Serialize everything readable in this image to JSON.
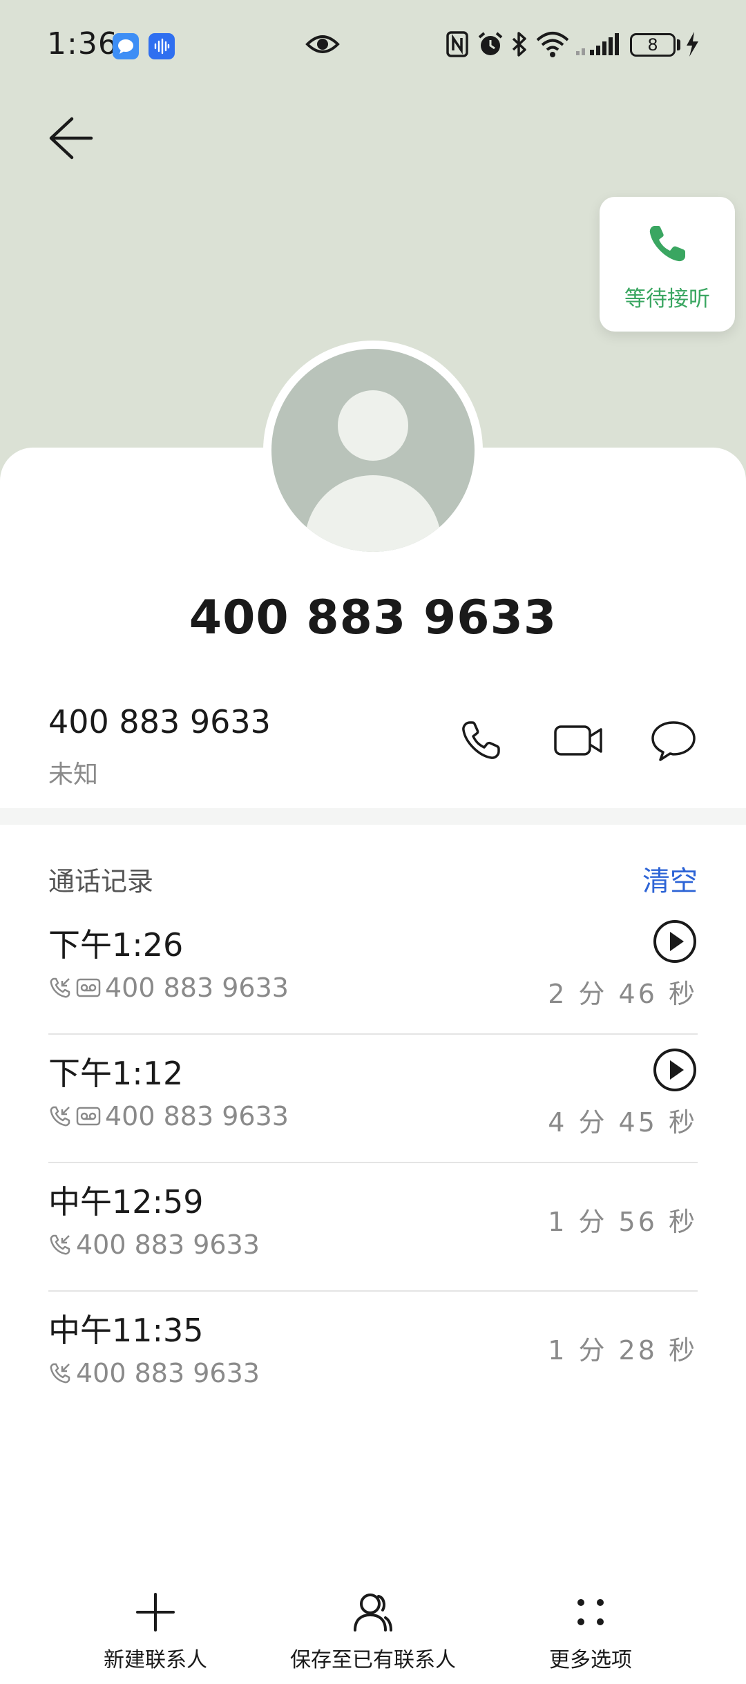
{
  "status_bar": {
    "time": "1:36",
    "battery_level": "8",
    "icons": [
      "message-app-icon",
      "voice-recorder-app-icon",
      "eye-icon",
      "nfc-icon",
      "alarm-icon",
      "bluetooth-icon",
      "wifi-icon",
      "signal-icon",
      "battery-icon",
      "charging-icon"
    ]
  },
  "header": {
    "back_icon": "arrow-left-icon"
  },
  "waiting_card": {
    "icon": "phone-icon",
    "label": "等待接听",
    "color": "#3aa661"
  },
  "contact": {
    "avatar_icon": "person-avatar-icon",
    "title_number": "400 883 9633",
    "number": "400 883 9633",
    "number_label": "未知",
    "actions": [
      {
        "name": "call",
        "icon": "phone-icon"
      },
      {
        "name": "video-call",
        "icon": "video-camera-icon"
      },
      {
        "name": "message",
        "icon": "chat-bubble-icon"
      }
    ]
  },
  "call_log": {
    "title": "通话记录",
    "clear_label": "清空",
    "clear_color": "#2d64d6",
    "items": [
      {
        "time": "下午1:26",
        "number": "400 883 9633",
        "duration": "2 分 46 秒",
        "has_recording": true
      },
      {
        "time": "下午1:12",
        "number": "400 883 9633",
        "duration": "4 分 45 秒",
        "has_recording": true
      },
      {
        "time": "中午12:59",
        "number": "400 883 9633",
        "duration": "1 分 56 秒",
        "has_recording": false
      },
      {
        "time": "中午11:35",
        "number": "400 883 9633",
        "duration": "1 分 28 秒",
        "has_recording": false
      }
    ]
  },
  "bottom_nav": {
    "items": [
      {
        "label": "新建联系人",
        "icon": "plus-icon"
      },
      {
        "label": "保存至已有联系人",
        "icon": "person-icon"
      },
      {
        "label": "更多选项",
        "icon": "more-dots-icon"
      }
    ]
  }
}
